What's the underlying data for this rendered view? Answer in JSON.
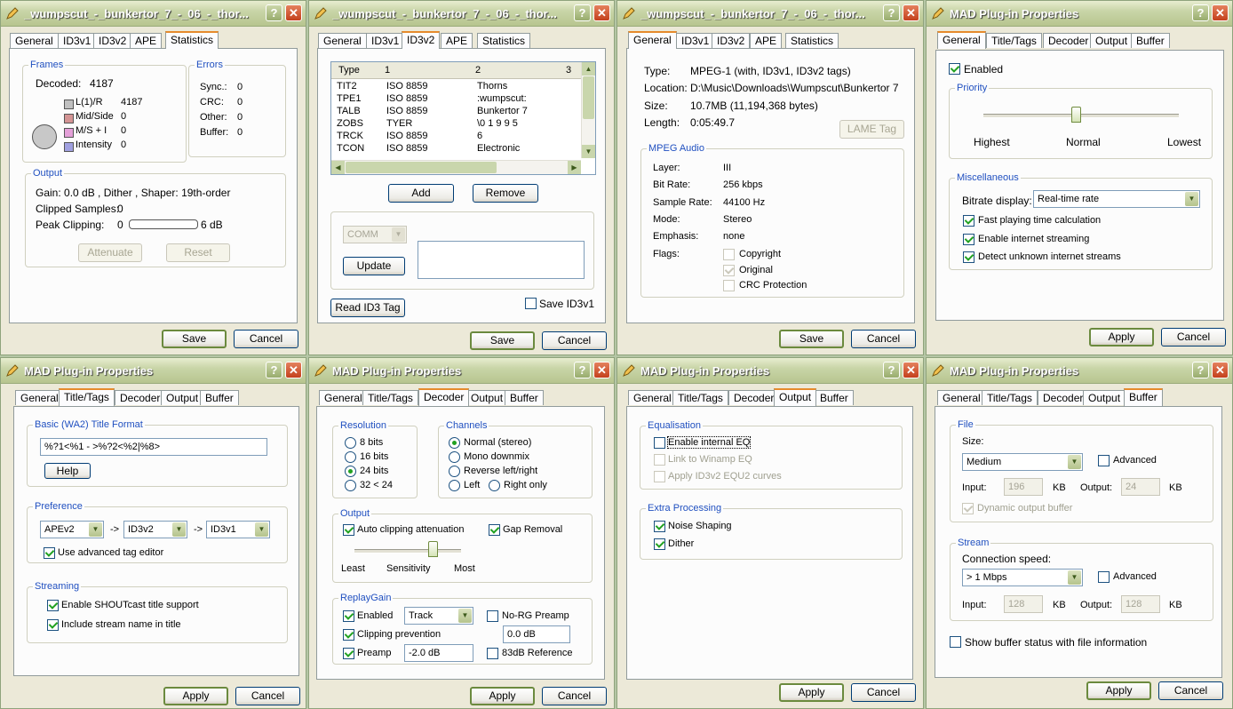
{
  "w1": {
    "title": "_wumpscut_-_bunkertor_7_-_06_-_thor...",
    "tabs": [
      "General",
      "ID3v1",
      "ID3v2",
      "APE",
      "Statistics"
    ],
    "frames_group": "Frames",
    "decoded_label": "Decoded:",
    "decoded_value": "4187",
    "lr_label": "L(1)/R",
    "lr_value": "4187",
    "mid_label": "Mid/Side",
    "mid_value": "0",
    "ms_label": "M/S + I",
    "ms_value": "0",
    "int_label": "Intensity",
    "int_value": "0",
    "errors_group": "Errors",
    "sync_label": "Sync.:",
    "sync_value": "0",
    "crc_label": "CRC:",
    "crc_value": "0",
    "other_label": "Other:",
    "other_value": "0",
    "buffer_label": "Buffer:",
    "buffer_value": "0",
    "output_group": "Output",
    "gain_text": "Gain: 0.0 dB , Dither , Shaper: 19th-order",
    "clipped_label": "Clipped Samples:",
    "clipped_value": "0",
    "peak_label": "Peak Clipping:",
    "peak_min": "0",
    "peak_max": "6 dB",
    "attenuate": "Attenuate",
    "reset": "Reset",
    "save": "Save",
    "cancel": "Cancel"
  },
  "w2": {
    "title": "_wumpscut_-_bunkertor_7_-_06_-_thor...",
    "tabs": [
      "General",
      "ID3v1",
      "ID3v2",
      "APE",
      "Statistics"
    ],
    "headers": [
      "Type",
      "1",
      "2",
      "3"
    ],
    "rows": [
      [
        "TIT2",
        "ISO 8859",
        "Thorns"
      ],
      [
        "TPE1",
        "ISO 8859",
        ":wumpscut:"
      ],
      [
        "TALB",
        "ISO 8859",
        "Bunkertor 7"
      ],
      [
        "ZOBS",
        "TYER",
        "\\0 1 9 9 5"
      ],
      [
        "TRCK",
        "ISO 8859",
        "6"
      ],
      [
        "TCON",
        "ISO 8859",
        "Electronic"
      ]
    ],
    "add": "Add",
    "remove": "Remove",
    "frame_combo": "COMM",
    "update": "Update",
    "read": "Read ID3 Tag",
    "save_id3v1": "Save ID3v1",
    "save": "Save",
    "cancel": "Cancel"
  },
  "w3": {
    "title": "_wumpscut_-_bunkertor_7_-_06_-_thor...",
    "tabs": [
      "General",
      "ID3v1",
      "ID3v2",
      "APE",
      "Statistics"
    ],
    "type_label": "Type:",
    "type_value": "MPEG-1  (with, ID3v1, ID3v2 tags)",
    "loc_label": "Location:",
    "loc_value": "D:\\Music\\Downloads\\Wumpscut\\Bunkertor 7",
    "size_label": "Size:",
    "size_value": "10.7MB (11,194,368 bytes)",
    "len_label": "Length:",
    "len_value": "0:05:49.7",
    "lame": "LAME Tag",
    "mpeg_group": "MPEG Audio",
    "layer_label": "Layer:",
    "layer_value": "III",
    "bitrate_label": "Bit Rate:",
    "bitrate_value": "256 kbps",
    "sample_label": "Sample Rate:",
    "sample_value": "44100 Hz",
    "mode_label": "Mode:",
    "mode_value": "Stereo",
    "emph_label": "Emphasis:",
    "emph_value": "none",
    "flags_label": "Flags:",
    "copyright": "Copyright",
    "original": "Original",
    "crc": "CRC Protection",
    "save": "Save",
    "cancel": "Cancel"
  },
  "w4": {
    "title": "MAD Plug-in Properties",
    "tabs": [
      "General",
      "Title/Tags",
      "Decoder",
      "Output",
      "Buffer"
    ],
    "enabled": "Enabled",
    "priority_group": "Priority",
    "highest": "Highest",
    "normal": "Normal",
    "lowest": "Lowest",
    "misc_group": "Miscellaneous",
    "bitrate_label": "Bitrate display:",
    "bitrate_value": "Real-time rate",
    "fast": "Fast playing time calculation",
    "streaming": "Enable internet streaming",
    "detect": "Detect unknown internet streams",
    "apply": "Apply",
    "cancel": "Cancel"
  },
  "w5": {
    "title": "MAD Plug-in Properties",
    "tabs": [
      "General",
      "Title/Tags",
      "Decoder",
      "Output",
      "Buffer"
    ],
    "basic_group": "Basic (WA2) Title Format",
    "format": "%?1<%1 - >%?2<%2|%8>",
    "help": "Help",
    "pref_group": "Preference",
    "pref1": "APEv2",
    "pref2": "ID3v2",
    "pref3": "ID3v1",
    "arrow": "->",
    "adv_editor": "Use advanced tag editor",
    "stream_group": "Streaming",
    "shoutcast": "Enable SHOUTcast title support",
    "include": "Include stream name in title",
    "apply": "Apply",
    "cancel": "Cancel"
  },
  "w6": {
    "title": "MAD Plug-in Properties",
    "tabs": [
      "General",
      "Title/Tags",
      "Decoder",
      "Output",
      "Buffer"
    ],
    "res_group": "Resolution",
    "r8": "8 bits",
    "r16": "16 bits",
    "r24": "24 bits",
    "r32": "32 < 24",
    "ch_group": "Channels",
    "normal": "Normal (stereo)",
    "mono": "Mono downmix",
    "reverse": "Reverse left/right",
    "left": "Left",
    "right": "Right only",
    "out_group": "Output",
    "auto_clip": "Auto clipping attenuation",
    "gap": "Gap Removal",
    "least": "Least",
    "sensitivity": "Sensitivity",
    "most": "Most",
    "rg_group": "ReplayGain",
    "enabled": "Enabled",
    "track": "Track",
    "norg": "No-RG Preamp",
    "clip_prev": "Clipping prevention",
    "norg_value": "0.0 dB",
    "preamp": "Preamp",
    "preamp_value": "-2.0 dB",
    "ref83": "83dB Reference",
    "apply": "Apply",
    "cancel": "Cancel"
  },
  "w7": {
    "title": "MAD Plug-in Properties",
    "tabs": [
      "General",
      "Title/Tags",
      "Decoder",
      "Output",
      "Buffer"
    ],
    "eq_group": "Equalisation",
    "enable_eq": "Enable internal EQ",
    "link_eq": "Link to Winamp EQ",
    "apply_eq": "Apply ID3v2 EQU2 curves",
    "extra_group": "Extra Processing",
    "noise": "Noise Shaping",
    "dither": "Dither",
    "apply": "Apply",
    "cancel": "Cancel"
  },
  "w8": {
    "title": "MAD Plug-in Properties",
    "tabs": [
      "General",
      "Title/Tags",
      "Decoder",
      "Output",
      "Buffer"
    ],
    "file_group": "File",
    "size_label": "Size:",
    "size_value": "Medium",
    "advanced": "Advanced",
    "input_label": "Input:",
    "input_value": "196",
    "kb": "KB",
    "output_label": "Output:",
    "output_value": "24",
    "dynamic": "Dynamic output buffer",
    "stream_group": "Stream",
    "speed_label": "Connection speed:",
    "speed_value": "> 1 Mbps",
    "s_input_value": "128",
    "s_output_value": "128",
    "show_status": "Show buffer status with file information",
    "apply": "Apply",
    "cancel": "Cancel"
  }
}
